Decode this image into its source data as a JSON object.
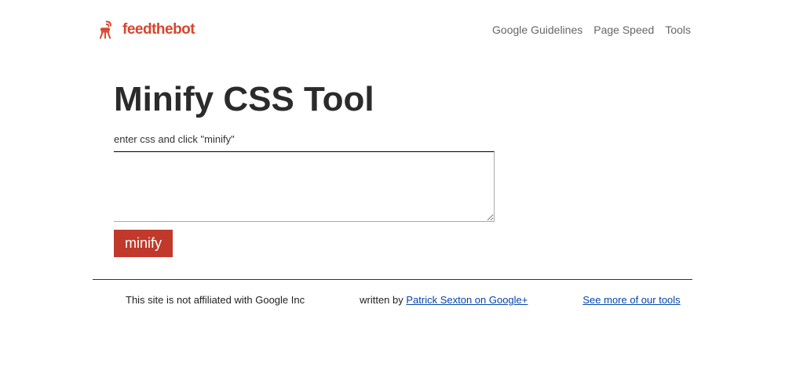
{
  "header": {
    "brand": "feedthebot",
    "nav": [
      {
        "label": "Google Guidelines"
      },
      {
        "label": "Page Speed"
      },
      {
        "label": "Tools"
      }
    ]
  },
  "main": {
    "title": "Minify CSS Tool",
    "instruction": "enter css and click \"minify\"",
    "textarea_value": "",
    "button_label": "minify"
  },
  "footer": {
    "disclaimer": "This site is not affiliated with Google Inc",
    "written_prefix": "written by ",
    "author_link": "Patrick Sexton on Google+",
    "tools_link": "See more of our tools"
  }
}
